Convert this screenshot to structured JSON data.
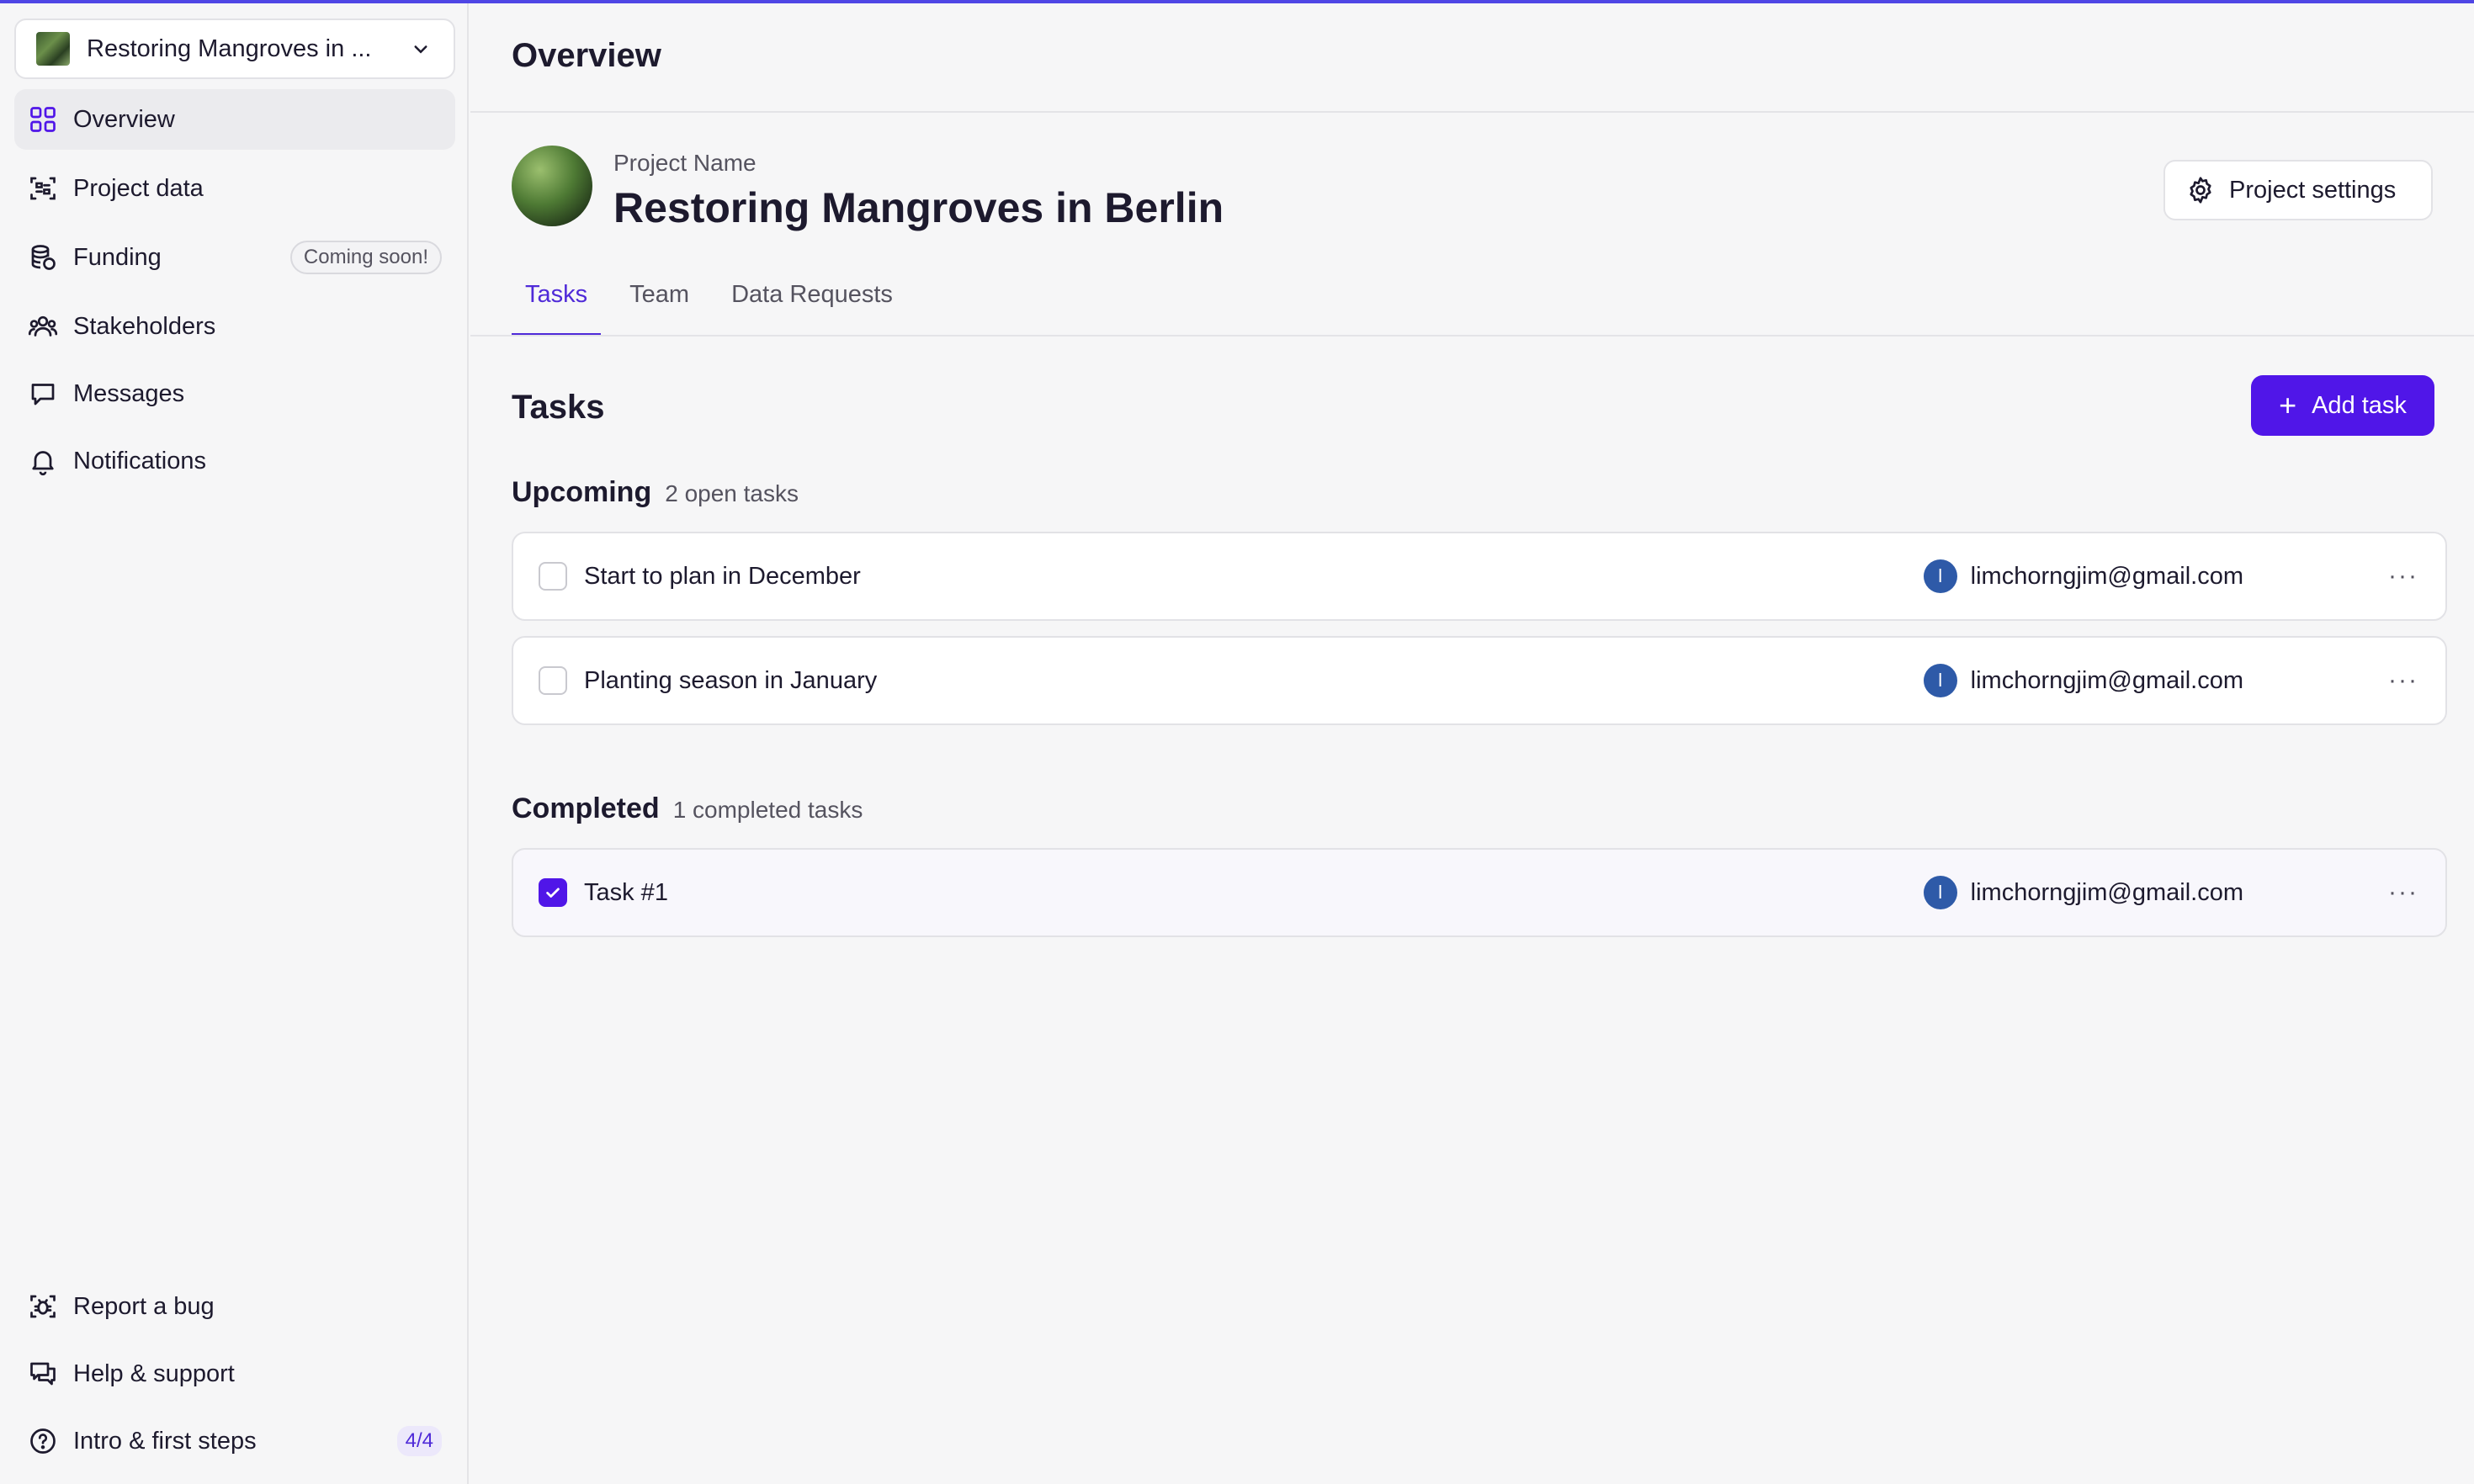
{
  "sidebar": {
    "project_select": "Restoring Mangroves in ...",
    "items": [
      {
        "label": "Overview"
      },
      {
        "label": "Project data"
      },
      {
        "label": "Funding",
        "badge": "Coming soon!"
      },
      {
        "label": "Stakeholders"
      },
      {
        "label": "Messages"
      },
      {
        "label": "Notifications"
      }
    ],
    "footer": [
      {
        "label": "Report a bug"
      },
      {
        "label": "Help & support"
      },
      {
        "label": "Intro & first steps",
        "badge": "4/4"
      }
    ]
  },
  "header": {
    "title": "Overview"
  },
  "project": {
    "label": "Project Name",
    "name": "Restoring Mangroves in Berlin",
    "settings_label": "Project settings"
  },
  "tabs": [
    {
      "label": "Tasks",
      "active": true
    },
    {
      "label": "Team"
    },
    {
      "label": "Data Requests"
    }
  ],
  "tasks": {
    "title": "Tasks",
    "add_label": "Add task",
    "upcoming": {
      "heading": "Upcoming",
      "count_text": "2 open tasks",
      "items": [
        {
          "name": "Start to plan in December",
          "assignee_initial": "l",
          "assignee": "limchorngjim@gmail.com"
        },
        {
          "name": "Planting season in January",
          "assignee_initial": "l",
          "assignee": "limchorngjim@gmail.com"
        }
      ]
    },
    "completed": {
      "heading": "Completed",
      "count_text": "1 completed tasks",
      "items": [
        {
          "name": "Task #1",
          "assignee_initial": "l",
          "assignee": "limchorngjim@gmail.com"
        }
      ]
    }
  },
  "colors": {
    "accent": "#5016e8",
    "avatar": "#2e5aa8"
  }
}
